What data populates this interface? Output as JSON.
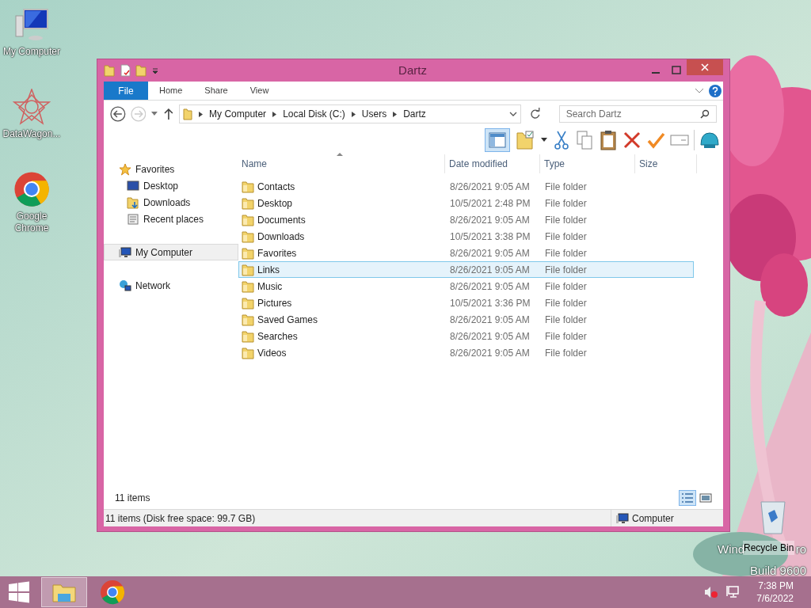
{
  "desktop_icons": [
    {
      "label": "My Computer",
      "kind": "computer"
    },
    {
      "label": "DataWagon...",
      "kind": "star"
    },
    {
      "label": "Google Chrome",
      "kind": "chrome"
    }
  ],
  "recycle_bin": {
    "label": "Recycle Bin"
  },
  "os_watermark": {
    "line_1_start": "Wind",
    "line_1_end": "ro",
    "line_2": "Build 9600"
  },
  "window": {
    "title": "Dartz"
  },
  "ribbon_tabs": [
    {
      "label": "File",
      "selected": true
    },
    {
      "label": "Home",
      "selected": false
    },
    {
      "label": "Share",
      "selected": false
    },
    {
      "label": "View",
      "selected": false
    }
  ],
  "address_bar": {
    "crumbs": [
      "My Computer",
      "Local Disk (C:)",
      "Users",
      "Dartz"
    ]
  },
  "search": {
    "placeholder": "Search Dartz"
  },
  "nav_pane": [
    {
      "label": "Favorites",
      "kind": "star",
      "selected": false,
      "children": [
        {
          "label": "Desktop",
          "kind": "desktop",
          "selected": false
        },
        {
          "label": "Downloads",
          "kind": "download",
          "selected": false
        },
        {
          "label": "Recent places",
          "kind": "recent",
          "selected": false
        }
      ]
    },
    {
      "label": "My Computer",
      "kind": "computer",
      "selected": true
    },
    {
      "label": "Network",
      "kind": "network",
      "selected": false
    }
  ],
  "table": {
    "columns": [
      "Name",
      "Date modified",
      "Type",
      "Size"
    ],
    "rows": [
      {
        "name": "Contacts",
        "date": "8/26/2021 9:05 AM",
        "type": "File folder",
        "selected": false
      },
      {
        "name": "Desktop",
        "date": "10/5/2021 2:48 PM",
        "type": "File folder",
        "selected": false
      },
      {
        "name": "Documents",
        "date": "8/26/2021 9:05 AM",
        "type": "File folder",
        "selected": false
      },
      {
        "name": "Downloads",
        "date": "10/5/2021 3:38 PM",
        "type": "File folder",
        "selected": false
      },
      {
        "name": "Favorites",
        "date": "8/26/2021 9:05 AM",
        "type": "File folder",
        "selected": false
      },
      {
        "name": "Links",
        "date": "8/26/2021 9:05 AM",
        "type": "File folder",
        "selected": true
      },
      {
        "name": "Music",
        "date": "8/26/2021 9:05 AM",
        "type": "File folder",
        "selected": false
      },
      {
        "name": "Pictures",
        "date": "10/5/2021 3:36 PM",
        "type": "File folder",
        "selected": false
      },
      {
        "name": "Saved Games",
        "date": "8/26/2021 9:05 AM",
        "type": "File folder",
        "selected": false
      },
      {
        "name": "Searches",
        "date": "8/26/2021 9:05 AM",
        "type": "File folder",
        "selected": false
      },
      {
        "name": "Videos",
        "date": "8/26/2021 9:05 AM",
        "type": "File folder",
        "selected": false
      }
    ]
  },
  "item_count": "11 items",
  "status_bar": {
    "left": "11 items (Disk free space: 99.7 GB)",
    "right": "Computer"
  },
  "clock": {
    "time": "7:38 PM",
    "date": "7/6/2022"
  }
}
